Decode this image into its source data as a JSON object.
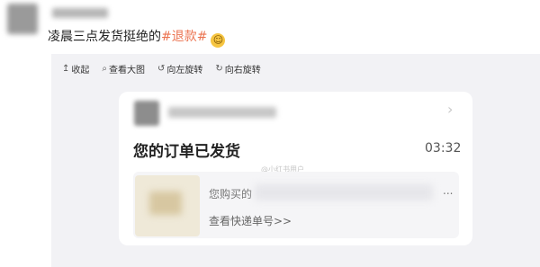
{
  "post": {
    "text": "凌晨三点发货挺绝的",
    "hashtag": "#退款#",
    "emoji": "sweat-smile-emoji"
  },
  "toolbar": {
    "items": [
      {
        "icon": "arrow-up-icon",
        "glyph": "↥",
        "label": "收起"
      },
      {
        "icon": "magnify-icon",
        "glyph": "⌕",
        "label": "查看大图"
      },
      {
        "icon": "rotate-left-icon",
        "glyph": "↺",
        "label": "向左旋转"
      },
      {
        "icon": "rotate-right-icon",
        "glyph": "↻",
        "label": "向右旋转"
      }
    ]
  },
  "card": {
    "title": "您的订单已发货",
    "time": "03:32",
    "watermark": "@小红书用户",
    "product_desc": "您购买的",
    "product_ellipsis": "...",
    "link": "查看快递单号>>"
  },
  "colors": {
    "hashtag": "#eb7350",
    "panel_bg": "#f2f2f5"
  }
}
